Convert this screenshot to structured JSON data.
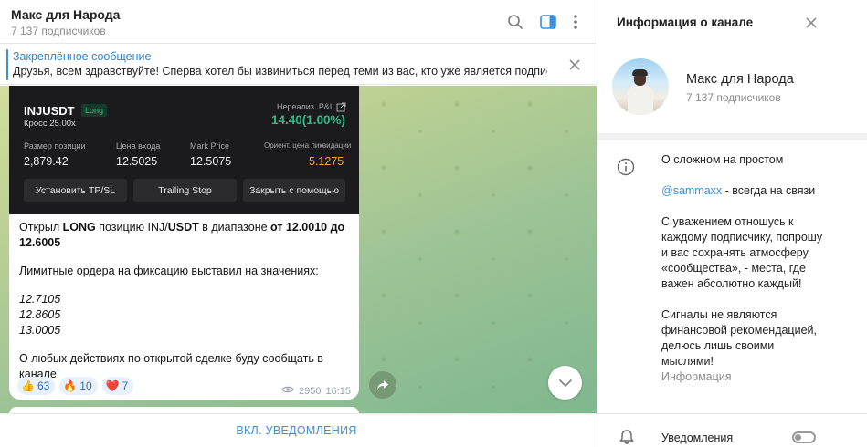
{
  "channel": {
    "title": "Макс для Народа",
    "subscribers": "7 137 подписчиков"
  },
  "pinned": {
    "label": "Закреплённое сообщение",
    "text": "Друзья, всем здравствуйте!   Сперва хотел бы извиниться перед теми из вас, кто уже является подписч..."
  },
  "trade_card": {
    "symbol": "INJUSDT",
    "side_badge": "Long",
    "margin": "Кросс 25.00x",
    "pnl_label": "Нереализ. P&L",
    "pnl_value": "14.40(1.00%)",
    "columns": [
      {
        "label": "Размер позиции",
        "value": "2,879.42"
      },
      {
        "label": "Цена входа",
        "value": "12.5025"
      },
      {
        "label": "Mark Price",
        "value": "12.5075"
      },
      {
        "label": "Ориент. цена ликвидации",
        "value": "5.1275"
      }
    ],
    "buttons": [
      "Установить TP/SL",
      "Trailing Stop",
      "Закрыть с помощью"
    ],
    "colors": {
      "profit": "#2ebd85",
      "liquidation": "#f0a83a",
      "badge": "#27c07e"
    }
  },
  "message": {
    "line1_a": "Открыл ",
    "line1_b": "LONG",
    "line1_c": " позицию INJ/",
    "line1_d": "USDT",
    "line1_e": " в диапазоне ",
    "line1_f": "от 12.0010 до 12.6005",
    "line2": "Лимитные ордера на фиксацию выставил на значениях:",
    "levels": [
      "12.7105",
      "12.8605",
      "13.0005"
    ],
    "line3": "О любых действиях по открытой сделке буду сообщать в канале!",
    "reactions": [
      {
        "emoji": "👍",
        "count": "63"
      },
      {
        "emoji": "🔥",
        "count": "10"
      },
      {
        "emoji": "❤️",
        "count": "7"
      }
    ],
    "views": "2950",
    "time": "16:15"
  },
  "bottom": {
    "unmute_label": "ВКЛ. УВЕДОМЛЕНИЯ"
  },
  "info_panel": {
    "title": "Информация о канале",
    "name": "Макс для Народа",
    "subscribers": "7 137 подписчиков",
    "desc_lines": {
      "l1": "О сложном на простом",
      "link": "@sammaxx",
      "link_suffix": " - всегда на связи",
      "p2": "С уважением отношусь к каждому подписчику, попрошу и вас сохранять атмосферу «сообщества», - места, где важен абсолютно каждый!",
      "p3": "Сигналы не являются финансовой рекомендацией, делюсь лишь своими мыслями!"
    },
    "desc_label": "Информация",
    "notifications_label": "Уведомления",
    "notifications_on": false
  },
  "icons": [
    "search-icon",
    "sidebar-toggle-icon",
    "more-vertical-icon",
    "close-icon",
    "external-link-icon",
    "eye-icon",
    "share-icon",
    "chevron-down-icon",
    "info-icon",
    "bell-icon"
  ]
}
